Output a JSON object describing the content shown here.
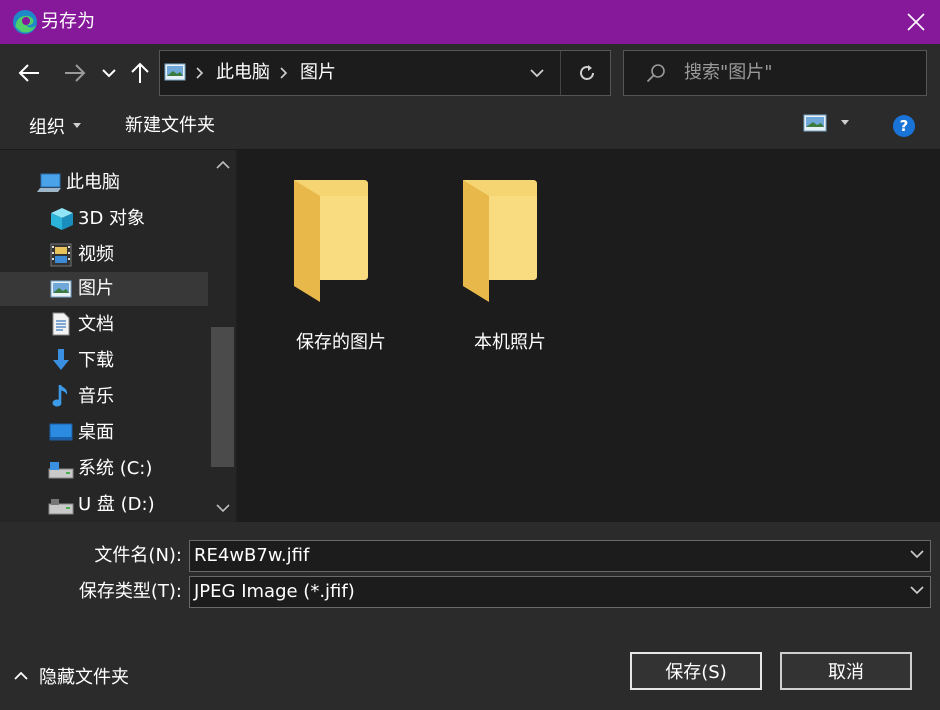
{
  "window": {
    "title": "另存为",
    "accent": "#86189a"
  },
  "nav": {
    "back_icon": "back-arrow-icon",
    "forward_icon": "forward-arrow-icon",
    "recent_icon": "chevron-down-icon",
    "up_icon": "up-arrow-icon",
    "breadcrumb": [
      "此电脑",
      "图片"
    ],
    "search_placeholder": "搜索\"图片\""
  },
  "toolbar": {
    "organize": "组织",
    "new_folder": "新建文件夹"
  },
  "sidebar": {
    "items": [
      {
        "label": "此电脑",
        "icon": "computer-icon"
      },
      {
        "label": "3D 对象",
        "icon": "cube-icon"
      },
      {
        "label": "视频",
        "icon": "film-icon"
      },
      {
        "label": "图片",
        "icon": "picture-icon",
        "selected": true
      },
      {
        "label": "文档",
        "icon": "document-icon"
      },
      {
        "label": "下载",
        "icon": "download-icon"
      },
      {
        "label": "音乐",
        "icon": "music-icon"
      },
      {
        "label": "桌面",
        "icon": "desktop-icon"
      },
      {
        "label": "系统 (C:)",
        "icon": "drive-icon"
      },
      {
        "label": "U 盘 (D:)",
        "icon": "usb-drive-icon"
      }
    ]
  },
  "folders": [
    {
      "label": "保存的图片"
    },
    {
      "label": "本机照片"
    }
  ],
  "form": {
    "filename_label": "文件名(N):",
    "filename_value": "RE4wB7w.jfif",
    "type_label": "保存类型(T):",
    "type_value": "JPEG Image (*.jfif)"
  },
  "footer": {
    "hide_folders": "隐藏文件夹",
    "save": "保存(S)",
    "cancel": "取消"
  }
}
